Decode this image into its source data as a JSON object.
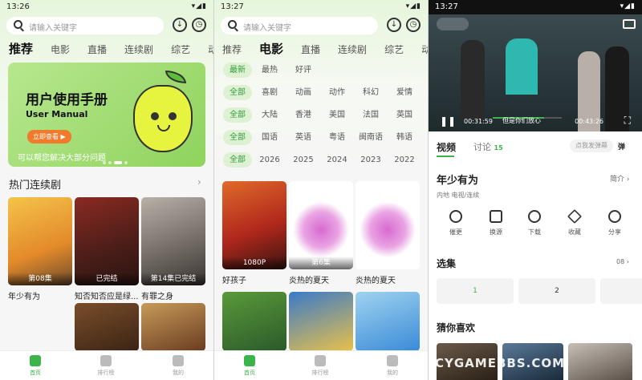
{
  "p1": {
    "time": "13:26",
    "search_ph": "请输入关键字",
    "tabs": [
      "推荐",
      "电影",
      "直播",
      "连续剧",
      "综艺",
      "动漫"
    ],
    "banner": {
      "title": "用户使用手册",
      "subtitle": "User Manual",
      "btn": "立即查看 ▶",
      "note": "可以帮您解决大部分问题"
    },
    "section": "热门连续剧",
    "cards": [
      {
        "ovl": "第08集",
        "title": "年少有为"
      },
      {
        "ovl": "已完结",
        "title": "知否知否应是绿..."
      },
      {
        "ovl": "第14集已完结",
        "title": "有罪之身"
      }
    ]
  },
  "p2": {
    "time": "13:27",
    "search_ph": "请输入关键字",
    "tabs": [
      "推荐",
      "电影",
      "直播",
      "连续剧",
      "综艺",
      "动漫"
    ],
    "filters": [
      [
        "最新",
        "最热",
        "好评"
      ],
      [
        "全部",
        "喜剧",
        "动画",
        "动作",
        "科幻",
        "爱情",
        "悬"
      ],
      [
        "全部",
        "大陆",
        "香港",
        "美国",
        "法国",
        "英国",
        "日"
      ],
      [
        "全部",
        "国语",
        "英语",
        "粤语",
        "闽南语",
        "韩语"
      ],
      [
        "全部",
        "2026",
        "2025",
        "2024",
        "2023",
        "2022"
      ]
    ],
    "cards": [
      {
        "ovl": "1080P",
        "title": "好孩子"
      },
      {
        "ovl": "第6集",
        "title": "炎热的夏天"
      },
      {
        "ovl": "",
        "title": "炎热的夏天"
      }
    ]
  },
  "p3": {
    "time": "13:27",
    "player": {
      "cur": "00:31:59",
      "dur": "00:43:26",
      "sub": "但是你们放心",
      "progress": 0.74
    },
    "tabs": {
      "video": "视频",
      "discuss": "讨论",
      "count": "15",
      "danmu": "点我发弹幕",
      "danmu_icon": "弹"
    },
    "title": "年少有为",
    "intro": "简介 ›",
    "meta": "内地  电视/连续",
    "actions": [
      "催更",
      "换源",
      "下载",
      "收藏",
      "分享"
    ],
    "episodes_label": "选集",
    "episodes_count": "08 ›",
    "episodes": [
      "1",
      "2"
    ],
    "guess": "猜你喜欢",
    "watermark": "CYGAMEBBS.COM"
  },
  "nav": [
    "首页",
    "排行榜",
    "我的"
  ],
  "colors": {
    "accent": "#3bb54a"
  }
}
